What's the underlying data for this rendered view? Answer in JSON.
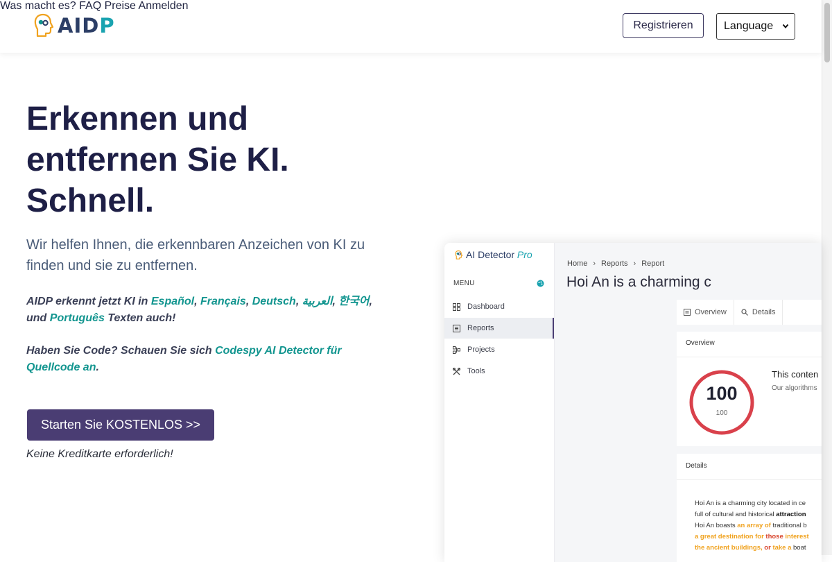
{
  "header": {
    "logo_text_main": "AID",
    "logo_text_accent": "P",
    "nav": [
      "Was macht es?",
      "FAQ",
      "Preise",
      "Anmelden"
    ],
    "register_label": "Registrieren",
    "language_label": "Language"
  },
  "hero": {
    "title_lines": [
      "Erkennen und",
      "entfernen Sie KI.",
      "Schnell."
    ],
    "subtitle": "Wir helfen Ihnen, die erkennbaren Anzeichen von KI zu finden und sie zu entfernen.",
    "lang_prefix": "AIDP erkennt jetzt KI in ",
    "languages": [
      "Español",
      "Français",
      "Deutsch",
      "العربية",
      "한국어",
      "Português"
    ],
    "lang_joiner": "und ",
    "lang_suffix": " Texten auch!",
    "code_prefix": "Haben Sie Code? Schauen Sie sich ",
    "code_link": "Codespy AI Detector für Quellcode an",
    "code_suffix": ".",
    "cta_label": "Starten Sie KOSTENLOS >>",
    "cta_note": "Keine Kreditkarte erforderlich!"
  },
  "preview": {
    "logo_text": "AI Detector",
    "logo_pro": "Pro",
    "menu_label": "MENU",
    "sidebar": [
      {
        "label": "Dashboard",
        "icon": "grid-icon"
      },
      {
        "label": "Reports",
        "icon": "report-icon",
        "active": true
      },
      {
        "label": "Projects",
        "icon": "projects-icon"
      },
      {
        "label": "Tools",
        "icon": "tools-icon"
      }
    ],
    "breadcrumb": [
      "Home",
      "Reports",
      "Report"
    ],
    "title": "Hoi An is a charming c",
    "tabs": [
      "Overview",
      "Details"
    ],
    "overview_header": "Overview",
    "score": "100",
    "score_sub": "100",
    "result_title": "This conten",
    "result_desc": "Our algorithms",
    "details_header": "Details",
    "details_lines": [
      [
        {
          "t": "Hoi An is a charming city located in ce",
          "c": ""
        }
      ],
      [
        {
          "t": "full of cultural and historical ",
          "c": ""
        },
        {
          "t": "attraction",
          "c": "bk"
        }
      ],
      [
        {
          "t": "Hoi An boasts ",
          "c": ""
        },
        {
          "t": "an array of",
          "c": "hl"
        },
        {
          "t": " traditional b",
          "c": ""
        }
      ],
      [
        {
          "t": "a great destination for",
          "c": "hl"
        },
        {
          "t": " ",
          "c": ""
        },
        {
          "t": "those",
          "c": "hr"
        },
        {
          "t": " ",
          "c": ""
        },
        {
          "t": "interest",
          "c": "hl"
        }
      ],
      [
        {
          "t": "the ancient buildings,",
          "c": "hl"
        },
        {
          "t": " ",
          "c": ""
        },
        {
          "t": "or",
          "c": "hr"
        },
        {
          "t": " ",
          "c": ""
        },
        {
          "t": "take a",
          "c": "hl"
        },
        {
          "t": " boat",
          "c": ""
        }
      ]
    ],
    "colors": {
      "gauge": "#d9414b",
      "highlight": "#f0a21e",
      "accent": "#12958f",
      "cta": "#4a3d73"
    }
  }
}
